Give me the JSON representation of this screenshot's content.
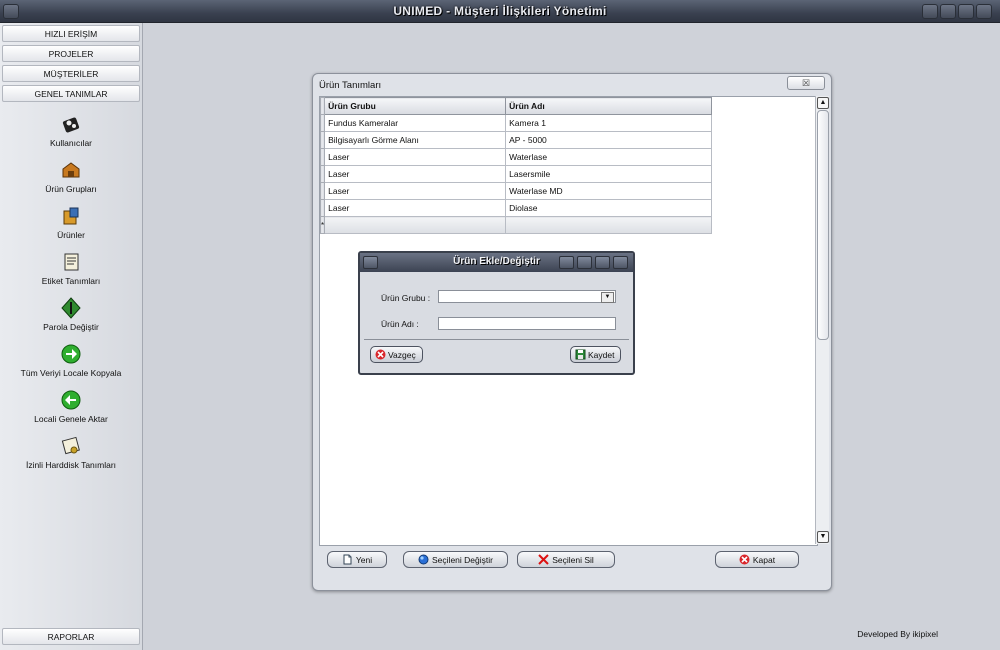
{
  "app": {
    "title": "UNIMED - Müşteri İlişkileri Yönetimi"
  },
  "sidebar": {
    "buttons": [
      "HIZLI ERİŞİM",
      "PROJELER",
      "MÜŞTERİLER",
      "GENEL TANIMLAR"
    ],
    "items": [
      {
        "label": "Kullanıcılar",
        "icon": "users-icon"
      },
      {
        "label": "Ürün Grupları",
        "icon": "product-groups-icon"
      },
      {
        "label": "Ürünler",
        "icon": "products-icon"
      },
      {
        "label": "Etiket Tanımları",
        "icon": "label-icon"
      },
      {
        "label": "Parola Değiştir",
        "icon": "password-icon"
      },
      {
        "label": "Tüm Veriyi Locale Kopyala",
        "icon": "arrow-right-green-icon"
      },
      {
        "label": "Locali Genele Aktar",
        "icon": "arrow-left-green-icon"
      },
      {
        "label": "İzinli Harddisk Tanımları",
        "icon": "harddisk-certificate-icon"
      }
    ],
    "bottom_button": "RAPORLAR"
  },
  "footer": {
    "credit": "Developed By ikipixel"
  },
  "window": {
    "title": "Ürün Tanımları",
    "close_glyph": "☒",
    "grid": {
      "columns": [
        "Ürün Grubu",
        "Ürün Adı"
      ],
      "rows": [
        [
          "Fundus Kameralar",
          "Kamera 1"
        ],
        [
          "Bilgisayarlı Görme Alanı",
          "AP - 5000"
        ],
        [
          "Laser",
          "Waterlase"
        ],
        [
          "Laser",
          "Lasersmile"
        ],
        [
          "Laser",
          "Waterlase MD"
        ],
        [
          "Laser",
          "Diolase"
        ]
      ],
      "new_row_marker": "*"
    },
    "buttons": {
      "new": "Yeni",
      "edit": "Seçileni Değiştir",
      "delete": "Seçileni Sil",
      "close": "Kapat"
    }
  },
  "dialog": {
    "title": "Ürün Ekle/Değiştir",
    "fields": {
      "group_label": "Ürün Grubu :",
      "group_value": "",
      "name_label": "Ürün Adı :",
      "name_value": ""
    },
    "buttons": {
      "cancel": "Vazgeç",
      "save": "Kaydet"
    }
  }
}
